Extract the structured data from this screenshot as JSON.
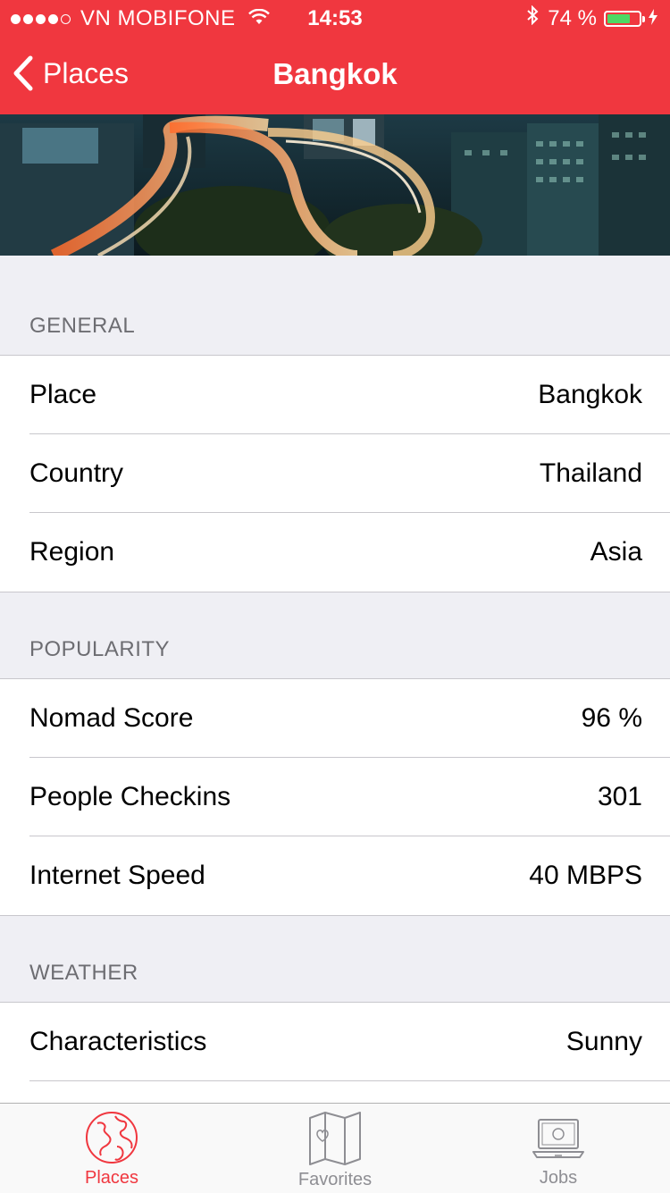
{
  "status_bar": {
    "carrier": "VN MOBIFONE",
    "time": "14:53",
    "battery": "74 %",
    "battery_level": 0.74,
    "signal_bars_filled": 4,
    "signal_bars_total": 5
  },
  "nav": {
    "back_label": "Places",
    "title": "Bangkok"
  },
  "sections": {
    "general": {
      "header": "GENERAL",
      "rows": [
        {
          "label": "Place",
          "value": "Bangkok"
        },
        {
          "label": "Country",
          "value": "Thailand"
        },
        {
          "label": "Region",
          "value": "Asia"
        }
      ]
    },
    "popularity": {
      "header": "POPULARITY",
      "rows": [
        {
          "label": "Nomad Score",
          "value": "96 %"
        },
        {
          "label": "People Checkins",
          "value": "301"
        },
        {
          "label": "Internet Speed",
          "value": "40 MBPS"
        }
      ]
    },
    "weather": {
      "header": "WEATHER",
      "rows": [
        {
          "label": "Characteristics",
          "value": "Sunny"
        }
      ]
    }
  },
  "tabs": [
    {
      "label": "Places",
      "icon": "globe-icon",
      "active": true
    },
    {
      "label": "Favorites",
      "icon": "map-icon",
      "active": false
    },
    {
      "label": "Jobs",
      "icon": "laptop-icon",
      "active": false
    }
  ],
  "colors": {
    "accent": "#f0373f",
    "background": "#efeff4",
    "tab_inactive": "#8e8e93",
    "battery_fill": "#4cd964"
  }
}
